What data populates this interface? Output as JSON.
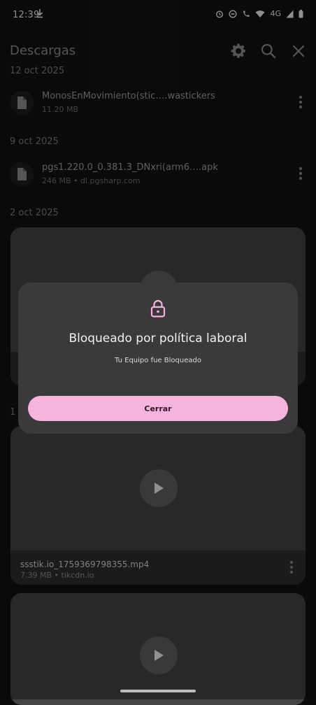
{
  "status_bar": {
    "time": "12:39",
    "network": "4G",
    "icons": [
      "download-icon",
      "alarm-icon",
      "dnd-icon",
      "wifi-calling-icon",
      "wifi-icon",
      "signal-icon",
      "battery-icon"
    ]
  },
  "app_bar": {
    "title": "Descargas",
    "actions": [
      "settings-icon",
      "search-icon",
      "close-icon"
    ]
  },
  "sections": [
    {
      "date": "12 oct 2025",
      "items": [
        {
          "name": "MonosEnMovimiento(stic….wastickers",
          "subtitle": "11.20 MB"
        }
      ]
    },
    {
      "date": "9 oct 2025",
      "items": [
        {
          "name": "pgs1.220.0_0.381.3_DNxri(arm6….apk",
          "subtitle": "246 MB • dl.pgsharp.com"
        }
      ]
    },
    {
      "date": "2 oct 2025",
      "items": []
    },
    {
      "date": "1",
      "items": [
        {
          "name": "ssstik.io_1759369798355.mp4",
          "subtitle": "7.39 MB • tikcdn.io"
        }
      ]
    }
  ],
  "dialog": {
    "icon": "lock-icon",
    "title": "Bloqueado por política laboral",
    "message": "Tu Equipo fue Bloqueado",
    "button_label": "Cerrar",
    "accent": "#f6b3dd"
  }
}
